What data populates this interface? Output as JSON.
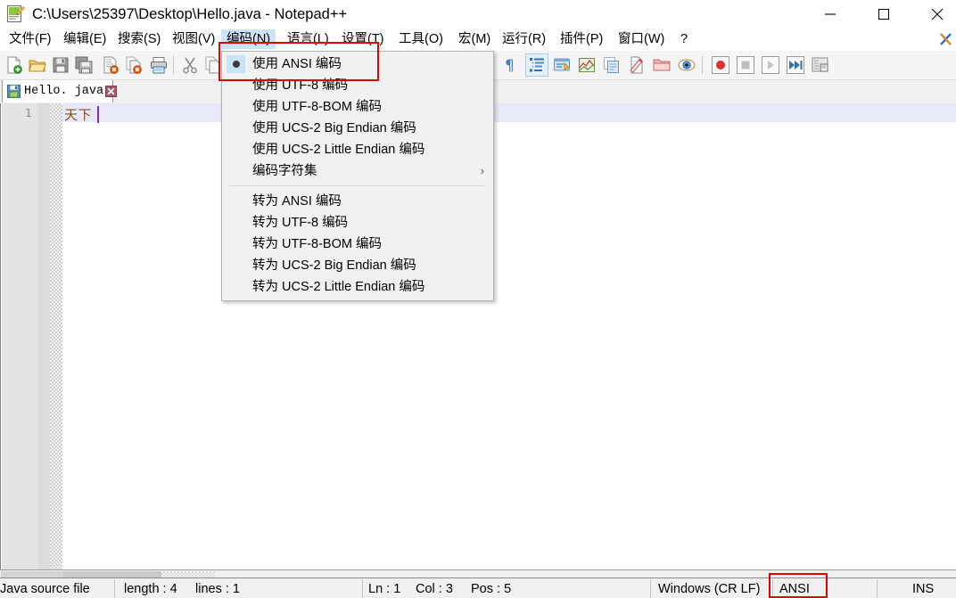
{
  "window": {
    "title": "C:\\Users\\25397\\Desktop\\Hello.java - Notepad++",
    "icon": "notepad-plus-plus-icon",
    "controls": {
      "minimize": "minimize-icon",
      "maximize": "maximize-icon",
      "close": "close-icon"
    }
  },
  "menubar": {
    "items": [
      {
        "label": "文件(F)",
        "mnemonic": "F",
        "active": false
      },
      {
        "label": "编辑(E)",
        "mnemonic": "E",
        "active": false
      },
      {
        "label": "搜索(S)",
        "mnemonic": "S",
        "active": false
      },
      {
        "label": "视图(V)",
        "mnemonic": "V",
        "active": false
      },
      {
        "label": "编码(N)",
        "mnemonic": "N",
        "active": true
      },
      {
        "label": "语言(L)",
        "mnemonic": "L",
        "active": false
      },
      {
        "label": "设置(T)",
        "mnemonic": "T",
        "active": false
      },
      {
        "label": "工具(O)",
        "mnemonic": "O",
        "active": false
      },
      {
        "label": "宏(M)",
        "mnemonic": "M",
        "active": false
      },
      {
        "label": "运行(R)",
        "mnemonic": "R",
        "active": false
      },
      {
        "label": "插件(P)",
        "mnemonic": "P",
        "active": false
      },
      {
        "label": "窗口(W)",
        "mnemonic": "W",
        "active": false
      },
      {
        "label": "?",
        "mnemonic": "",
        "active": false
      }
    ],
    "close_document_icon": "close-document-x-icon"
  },
  "toolbar": {
    "buttons": [
      "new-file-icon",
      "open-file-icon",
      "save-icon",
      "save-all-icon",
      "close-file-icon",
      "close-all-files-icon",
      "print-icon",
      "cut-icon",
      "copy-icon",
      "paste-icon",
      "undo-icon",
      "redo-icon",
      "find-icon",
      "replace-icon",
      "zoom-in-icon",
      "zoom-out-icon",
      "sync-vertical-scroll-icon",
      "sync-horizontal-scroll-icon",
      "word-wrap-icon",
      "show-all-characters-icon",
      "show-indent-guide-icon",
      "user-defined-language-icon",
      "document-map-icon",
      "function-list-icon",
      "document-switcher-icon",
      "folder-as-workspace-icon",
      "monitoring-icon",
      "record-macro-icon",
      "stop-recording-icon",
      "play-macro-icon",
      "run-macro-multiple-icon",
      "save-macro-icon"
    ]
  },
  "tabs": [
    {
      "label": "Hello. java",
      "icon": "saved-file-icon",
      "close": "tab-close-icon",
      "active": true
    }
  ],
  "editor": {
    "lines": [
      {
        "number": "1",
        "text": "天下"
      }
    ],
    "caret_line": 1,
    "caret_col": 3
  },
  "dropdown": {
    "title": "编码(N)",
    "groups": [
      {
        "items": [
          {
            "label": "使用 ANSI 编码",
            "checked": true
          },
          {
            "label": "使用 UTF-8 编码",
            "checked": false
          },
          {
            "label": "使用 UTF-8-BOM 编码",
            "checked": false
          },
          {
            "label": "使用 UCS-2 Big Endian 编码",
            "checked": false
          },
          {
            "label": "使用 UCS-2 Little Endian 编码",
            "checked": false
          },
          {
            "label": "编码字符集",
            "checked": false,
            "submenu": true,
            "submenu_arrow": "›"
          }
        ]
      },
      {
        "items": [
          {
            "label": "转为 ANSI 编码",
            "checked": false
          },
          {
            "label": "转为 UTF-8 编码",
            "checked": false
          },
          {
            "label": "转为 UTF-8-BOM 编码",
            "checked": false
          },
          {
            "label": "转为 UCS-2 Big Endian 编码",
            "checked": false
          },
          {
            "label": "转为 UCS-2 Little Endian 编码",
            "checked": false
          }
        ]
      }
    ]
  },
  "statusbar": {
    "file_type": "Java source file",
    "length": "length : 4",
    "lines": "lines : 1",
    "ln": "Ln : 1",
    "col": "Col : 3",
    "pos": "Pos : 5",
    "eol": "Windows (CR LF)",
    "encoding": "ANSI",
    "insert_mode": "INS"
  },
  "annotations": {
    "color": "#e60000",
    "boxes": [
      {
        "name": "encoding-menu-highlight"
      },
      {
        "name": "status-encoding-highlight"
      }
    ]
  }
}
